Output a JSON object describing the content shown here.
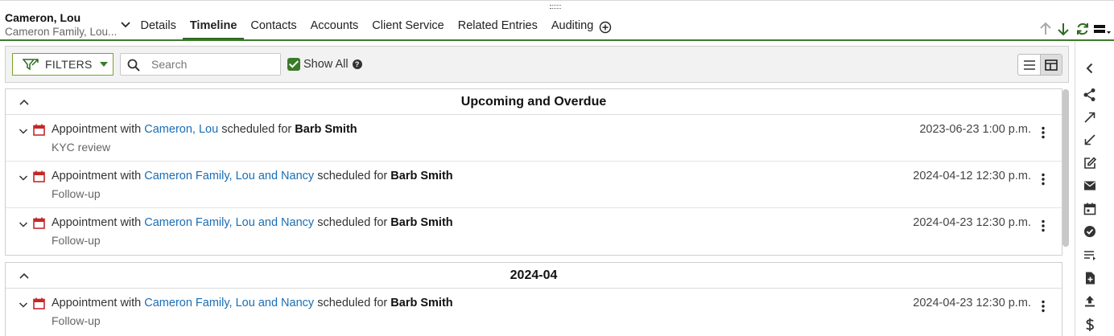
{
  "client": {
    "name": "Cameron, Lou",
    "subtitle": "Cameron Family, Lou..."
  },
  "tabs": [
    {
      "label": "Details",
      "active": false
    },
    {
      "label": "Timeline",
      "active": true
    },
    {
      "label": "Contacts",
      "active": false
    },
    {
      "label": "Accounts",
      "active": false
    },
    {
      "label": "Client Service",
      "active": false
    },
    {
      "label": "Related Entries",
      "active": false
    },
    {
      "label": "Auditing",
      "active": false
    }
  ],
  "toolbar": {
    "filters_label": "FILTERS",
    "search_placeholder": "Search",
    "search_value": "",
    "show_all_label": "Show All",
    "show_all_checked": true,
    "help_glyph": "?"
  },
  "groups": [
    {
      "title": "Upcoming and Overdue",
      "entries": [
        {
          "prefix": "Appointment with",
          "link": "Cameron, Lou",
          "middle": "scheduled for",
          "person": "Barb Smith",
          "note": "KYC review",
          "date": "2023-06-23 1:00 p.m."
        },
        {
          "prefix": "Appointment with",
          "link": "Cameron Family, Lou and Nancy",
          "middle": "scheduled for",
          "person": "Barb Smith",
          "note": "Follow-up",
          "date": "2024-04-12 12:30 p.m."
        },
        {
          "prefix": "Appointment with",
          "link": "Cameron Family, Lou and Nancy",
          "middle": "scheduled for",
          "person": "Barb Smith",
          "note": "Follow-up",
          "date": "2024-04-23 12:30 p.m."
        }
      ]
    },
    {
      "title": "2024-04",
      "entries": [
        {
          "prefix": "Appointment with",
          "link": "Cameron Family, Lou and Nancy",
          "middle": "scheduled for",
          "person": "Barb Smith",
          "note": "Follow-up",
          "date": "2024-04-23 12:30 p.m."
        }
      ]
    }
  ],
  "colors": {
    "accent": "#3b7a2a",
    "link": "#1a6db5",
    "calendar": "#c62828"
  },
  "icons": {
    "header": [
      "arrow-up-icon",
      "arrow-down-icon",
      "refresh-icon",
      "layout-menu-icon"
    ],
    "rail": [
      "chevron-left-icon",
      "share-icon",
      "expand-icon",
      "collapse-icon",
      "edit-icon",
      "mail-icon",
      "calendar-icon",
      "check-circle-icon",
      "playlist-add-icon",
      "new-document-icon",
      "upload-icon",
      "dollar-icon"
    ]
  }
}
